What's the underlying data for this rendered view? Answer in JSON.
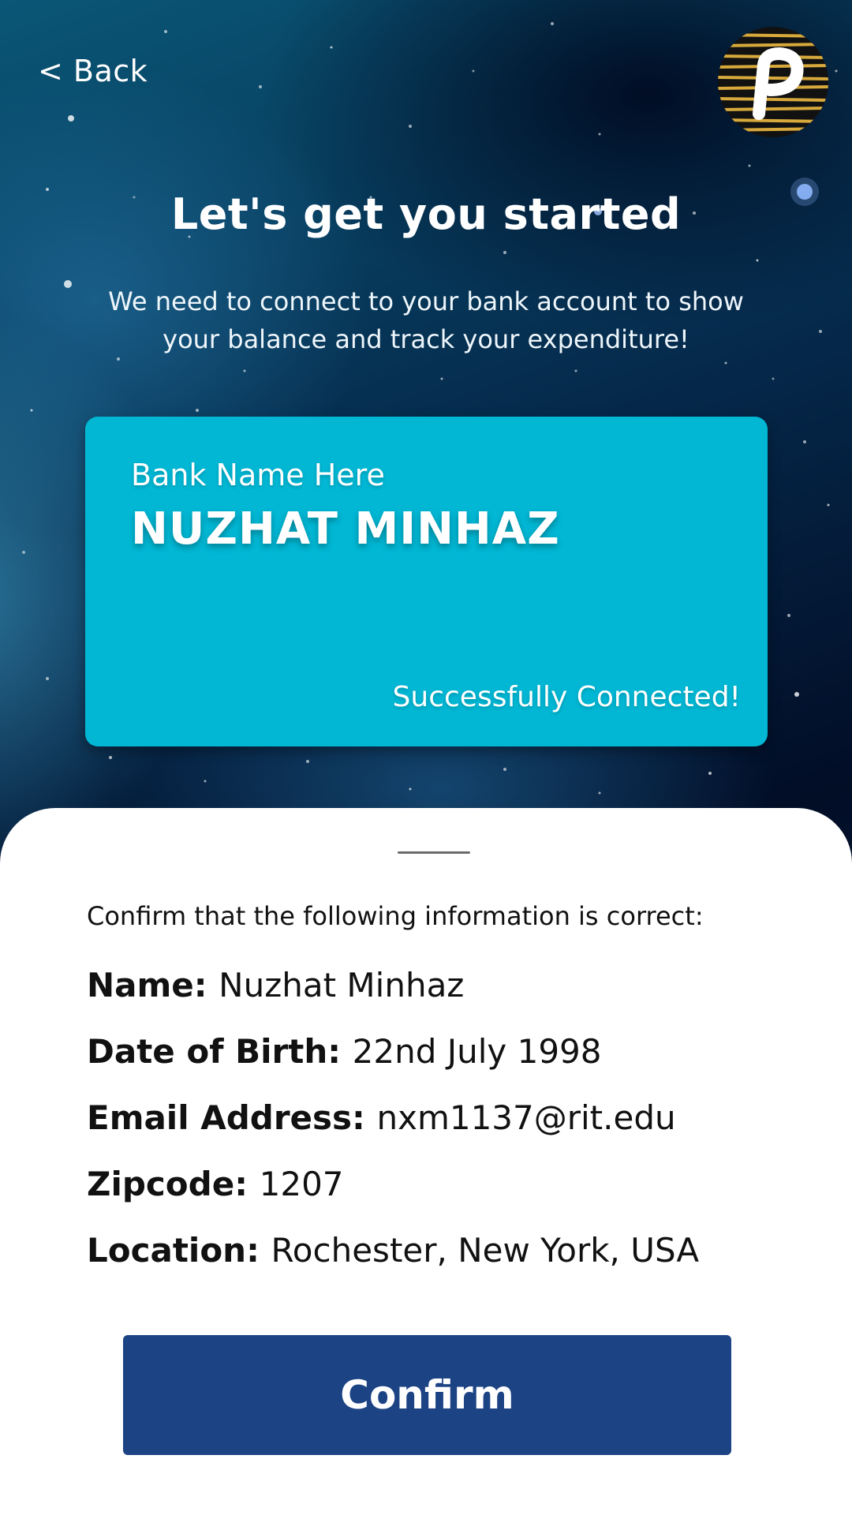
{
  "header": {
    "back_label": "< Back",
    "logo_icon": "p-logo-icon"
  },
  "intro": {
    "title": "Let's get you started",
    "subtitle": "We need to connect to your bank account to show your balance and track your expenditure!"
  },
  "bank_card": {
    "bank_name": "Bank Name Here",
    "holder_name": "NUZHAT MINHAZ",
    "status": "Successfully Connected!",
    "color": "#01b7d4"
  },
  "confirm_sheet": {
    "prompt": "Confirm that the following information is correct:",
    "fields": [
      {
        "label": "Name:",
        "value": "Nuzhat Minhaz"
      },
      {
        "label": "Date of Birth:",
        "value": "22nd July 1998"
      },
      {
        "label": "Email Address:",
        "value": "nxm1137@rit.edu"
      },
      {
        "label": "Zipcode:",
        "value": "1207"
      },
      {
        "label": "Location:",
        "value": "Rochester, New York, USA"
      }
    ],
    "confirm_label": "Confirm",
    "button_color": "#1c4384"
  }
}
